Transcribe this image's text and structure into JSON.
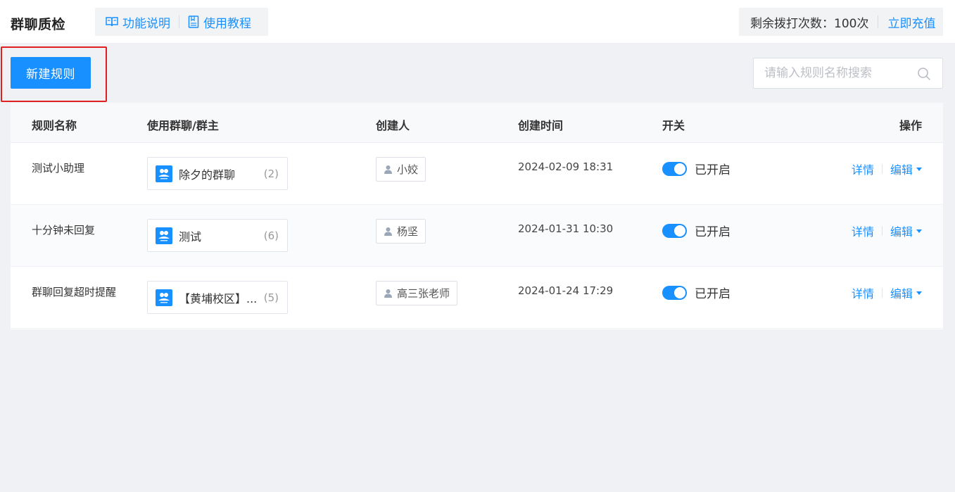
{
  "header": {
    "title": "群聊质检",
    "help_links": [
      {
        "label": "功能说明",
        "icon": "book-open-icon"
      },
      {
        "label": "使用教程",
        "icon": "document-icon"
      }
    ],
    "credit_label": "剩余拨打次数：",
    "credit_count": "100次",
    "recharge_label": "立即充值"
  },
  "toolbar": {
    "new_rule_label": "新建规则",
    "search_placeholder": "请输入规则名称搜索"
  },
  "table": {
    "columns": [
      "规则名称",
      "使用群聊/群主",
      "创建人",
      "创建时间",
      "开关",
      "操作"
    ],
    "rows": [
      {
        "name": "测试小助理",
        "group": "除夕的群聊",
        "group_count": "(2)",
        "creator": "小姣",
        "created": "2024-02-09 18:31",
        "switch_label": "已开启",
        "switch_on": true,
        "detail": "详情",
        "edit": "编辑"
      },
      {
        "name": "十分钟未回复",
        "group": "测试",
        "group_count": "(6)",
        "creator": "杨坚",
        "created": "2024-01-31 10:30",
        "switch_label": "已开启",
        "switch_on": true,
        "detail": "详情",
        "edit": "编辑"
      },
      {
        "name": "群聊回复超时提醒",
        "group": "【黄埔校区】...",
        "group_count": "(5)",
        "creator": "高三张老师",
        "created": "2024-01-24 17:29",
        "switch_label": "已开启",
        "switch_on": true,
        "detail": "详情",
        "edit": "编辑"
      }
    ]
  },
  "colors": {
    "accent": "#1890ff",
    "highlight_border": "#e02020",
    "page_bg": "#f0f1f5"
  }
}
